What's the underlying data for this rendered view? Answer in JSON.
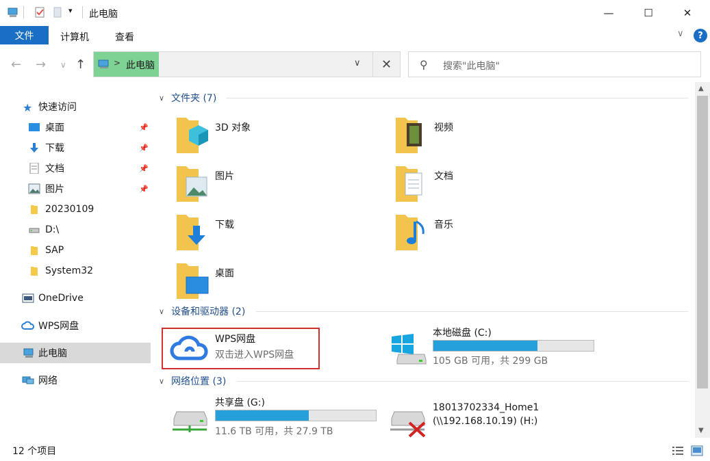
{
  "window": {
    "title": "此电脑",
    "minimize": "—",
    "maximize": "☐",
    "close": "✕"
  },
  "ribbon": {
    "file_tab": "文件",
    "tabs": [
      "计算机",
      "查看"
    ],
    "help": "?",
    "expand": "∨"
  },
  "address": {
    "path": "此电脑",
    "separator": ">",
    "dropdown": "∨",
    "clear": "✕"
  },
  "search": {
    "placeholder": "搜索\"此电脑\"",
    "icon": "⚲"
  },
  "nav": {
    "back": "←",
    "forward": "→",
    "recent": "∨",
    "up": "↑"
  },
  "sidebar": {
    "items": [
      {
        "label": "快速访问",
        "icon": "star-icon"
      },
      {
        "label": "桌面",
        "icon": "desktop-icon",
        "pinned": true
      },
      {
        "label": "下载",
        "icon": "download-icon",
        "pinned": true
      },
      {
        "label": "文档",
        "icon": "document-icon",
        "pinned": true
      },
      {
        "label": "图片",
        "icon": "picture-icon",
        "pinned": true
      },
      {
        "label": "20230109",
        "icon": "folder-icon"
      },
      {
        "label": "D:\\",
        "icon": "drive-icon"
      },
      {
        "label": "SAP",
        "icon": "folder-icon"
      },
      {
        "label": "System32",
        "icon": "folder-icon"
      },
      {
        "label": "OneDrive",
        "icon": "onedrive-icon"
      },
      {
        "label": "WPS网盘",
        "icon": "cloud-icon"
      },
      {
        "label": "此电脑",
        "icon": "computer-icon",
        "selected": true
      },
      {
        "label": "网络",
        "icon": "network-icon"
      }
    ],
    "pin_glyph": "📌"
  },
  "groups": {
    "folders": {
      "title": "文件夹 (7)",
      "items": [
        "3D 对象",
        "视频",
        "图片",
        "文档",
        "下载",
        "音乐",
        "桌面"
      ]
    },
    "devices": {
      "title": "设备和驱动器 (2)",
      "wps": {
        "name": "WPS网盘",
        "sub": "双击进入WPS网盘"
      },
      "local": {
        "name": "本地磁盘 (C:)",
        "space": "105 GB 可用，共 299 GB",
        "used_fraction": 0.65
      }
    },
    "network": {
      "title": "网络位置 (3)",
      "share": {
        "name": "共享盘 (G:)",
        "space": "11.6 TB 可用，共 27.9 TB",
        "used_fraction": 0.58
      },
      "home": {
        "name": "18013702334_Home1",
        "path": "(\\\\192.168.10.19) (H:)"
      }
    }
  },
  "status": {
    "count": "12 个项目"
  },
  "colors": {
    "accent": "#1a6fc4",
    "address_highlight": "#7ed394",
    "bar_fill": "#26a0da",
    "highlight_box": "#d32f2f"
  }
}
